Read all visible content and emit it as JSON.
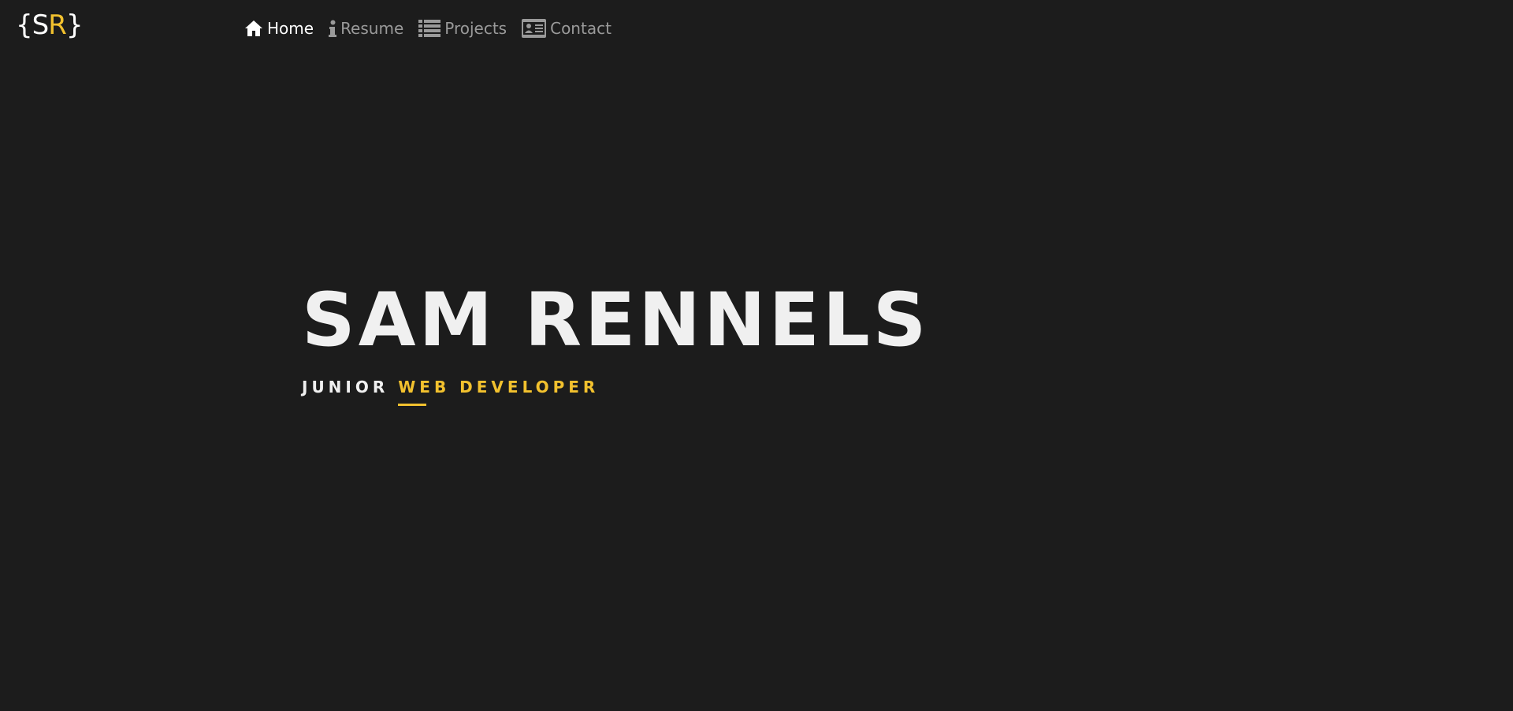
{
  "logo": {
    "open": "{",
    "first": "S",
    "second": "R",
    "close": "}"
  },
  "nav": {
    "items": [
      {
        "label": "Home",
        "icon": "home-icon",
        "active": true
      },
      {
        "label": "Resume",
        "icon": "info-icon",
        "active": false
      },
      {
        "label": "Projects",
        "icon": "list-icon",
        "active": false
      },
      {
        "label": "Contact",
        "icon": "contact-card-icon",
        "active": false
      }
    ]
  },
  "hero": {
    "name": "SAM RENNELS",
    "subtitle_prefix": "JUNIOR",
    "subtitle_accent": "WEB DEVELOPER"
  },
  "colors": {
    "background": "#1c1c1c",
    "accent": "#f2c12e",
    "text": "#f0f0f0",
    "muted": "#9a9a9a"
  }
}
